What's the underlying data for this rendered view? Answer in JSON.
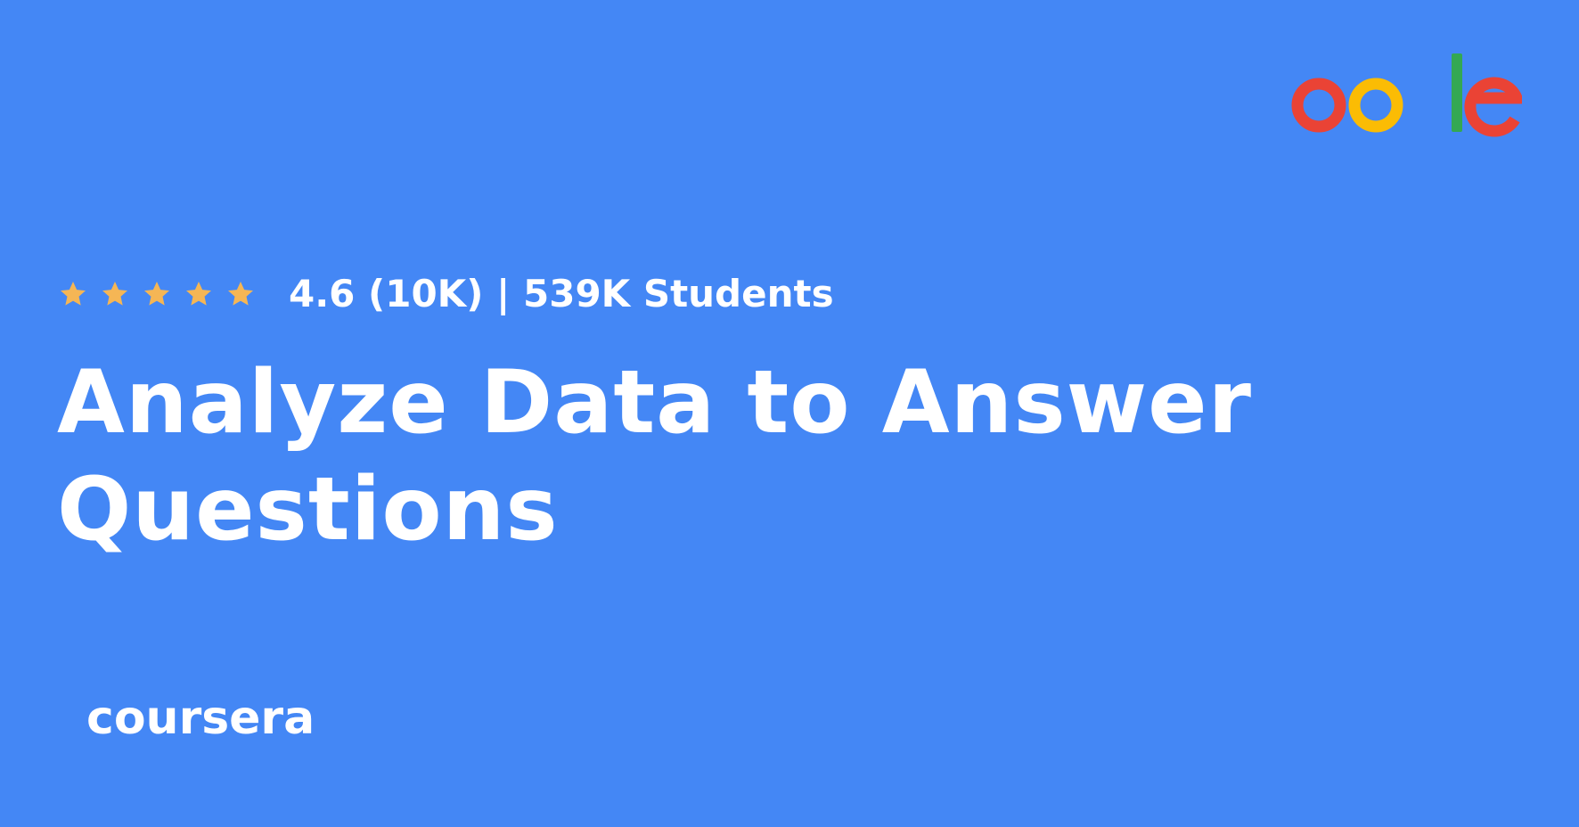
{
  "rating": {
    "stars": 5,
    "text": "4.6 (10K) | 539K Students",
    "star_color": "#f5b655"
  },
  "course": {
    "title_lines": [
      "Analyze Data to Answer",
      "Questions"
    ]
  },
  "branding": {
    "platform_logo": "coursera",
    "partner_logo": "oo le",
    "partner_logo_colors": {
      "o1": "#ea4335",
      "o2": "#fbbc04",
      "l": "#34a853",
      "e": "#ea4335"
    }
  },
  "colors": {
    "background": "#4487f5",
    "text": "#ffffff"
  }
}
